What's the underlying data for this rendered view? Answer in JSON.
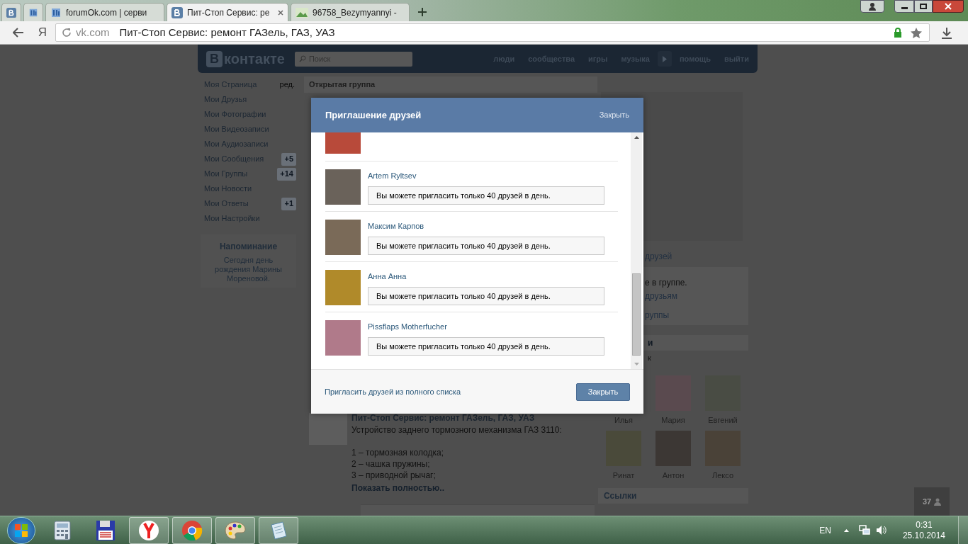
{
  "browser": {
    "tabs": [
      {
        "kind": "pinned",
        "selected": false
      },
      {
        "kind": "pinned",
        "selected": false
      },
      {
        "kind": "page",
        "title": "forumOk.com | серви",
        "selected": false
      },
      {
        "kind": "page",
        "title": "Пит-Стоп Сервис: ре",
        "selected": true
      },
      {
        "kind": "page",
        "title": "96758_Bezymyannyi - ",
        "selected": false
      }
    ],
    "yandex_button": "Я",
    "address": {
      "host": "vk.com",
      "title": "Пит-Стоп Сервис: ремонт ГАЗель, ГАЗ, УАЗ"
    }
  },
  "vk_header": {
    "logo_letter": "В",
    "logo_text": "контакте",
    "search_placeholder": "Поиск",
    "nav": [
      {
        "kind": "link",
        "label": "люди"
      },
      {
        "kind": "link",
        "label": "сообщества"
      },
      {
        "kind": "link",
        "label": "игры"
      },
      {
        "kind": "link",
        "label": "музыка"
      },
      {
        "kind": "play"
      },
      {
        "kind": "link",
        "label": "помощь"
      },
      {
        "kind": "link",
        "label": "выйти"
      }
    ]
  },
  "sidebar": {
    "items": [
      {
        "label": "Моя Страница",
        "extra": "ред."
      },
      {
        "label": "Мои Друзья"
      },
      {
        "label": "Мои Фотографии"
      },
      {
        "label": "Мои Видеозаписи"
      },
      {
        "label": "Мои Аудиозаписи"
      },
      {
        "label": "Мои Сообщения",
        "count": "+5"
      },
      {
        "label": "Мои Группы",
        "count": "+14"
      },
      {
        "label": "Мои Новости"
      },
      {
        "label": "Мои Ответы",
        "count": "+1"
      },
      {
        "label": "Мои Настройки"
      }
    ],
    "reminder": {
      "title": "Напоминание",
      "text": "Сегодня день рождения Марины Мореновой."
    }
  },
  "main": {
    "header": "Открытая группа",
    "post": {
      "title": "Пит-Стоп Сервис: ремонт ГАЗель, ГАЗ, УАЗ",
      "intro": "Устройство заднего тормозного механизма ГАЗ 3110:",
      "lines": [
        "1 – тормозная колодка;",
        "2 – чашка пружины;",
        "3 – приводной рычаг;"
      ],
      "more": "Показать полностью.."
    }
  },
  "right": {
    "invite_link": "друзей",
    "box_lines": [
      "е в группе.",
      "друзьям",
      "руппы"
    ],
    "members_header": "и",
    "members_sub": "к",
    "members": [
      "Илья",
      "Мария",
      "Евгений",
      "Ринат",
      "Антон",
      "Лексо"
    ],
    "links_header": "Ссылки"
  },
  "modal": {
    "title": "Приглашение друзей",
    "close_link": "Закрыть",
    "friends": [
      {
        "name": "Artem Ryltsev",
        "note": "Вы можете пригласить только 40 друзей в день."
      },
      {
        "name": "Максим Карпов",
        "note": "Вы можете пригласить только 40 друзей в день."
      },
      {
        "name": "Анна Анна",
        "note": "Вы можете пригласить только 40 друзей в день."
      },
      {
        "name": "Pissflaps Motherfucher",
        "note": "Вы можете пригласить только 40 друзей в день."
      }
    ],
    "footer_link": "Пригласить друзей из полного списка",
    "button": "Закрыть"
  },
  "counter": "37",
  "taskbar": {
    "apps": [
      {
        "kind": "calculator",
        "running": false
      },
      {
        "kind": "disk",
        "running": false
      },
      {
        "kind": "yandex",
        "running": true
      },
      {
        "kind": "chrome",
        "running": true
      },
      {
        "kind": "paint",
        "running": true
      },
      {
        "kind": "notes",
        "running": true
      }
    ],
    "language": "EN",
    "time": "0:31",
    "date": "25.10.2014"
  }
}
